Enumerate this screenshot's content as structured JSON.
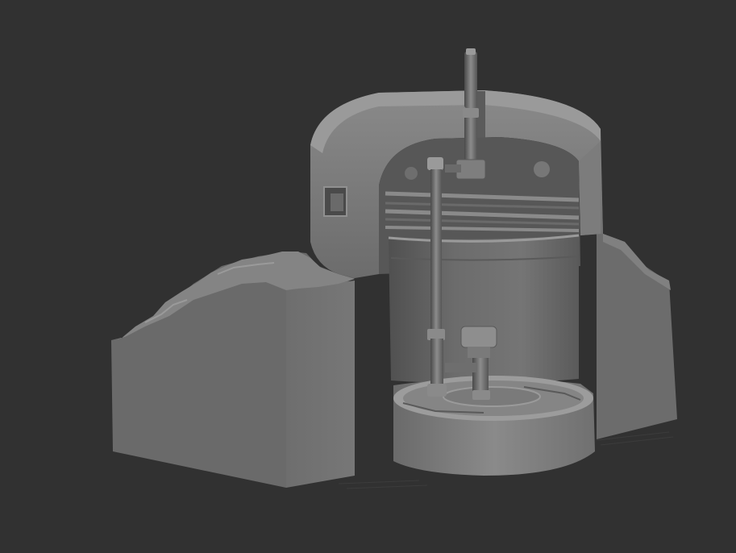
{
  "viewport": {
    "background_color": "#313131",
    "model_color": "#7a7a7a",
    "subject": "sculpted-bunker-cutaway-model"
  }
}
